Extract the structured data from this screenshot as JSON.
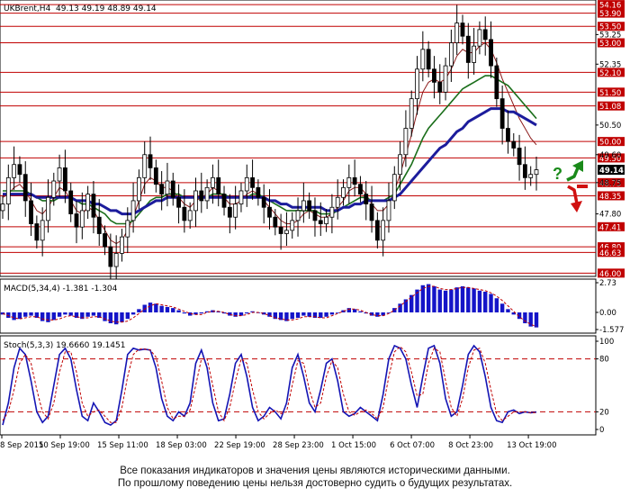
{
  "header": {
    "symbol": "UKBrent,H4",
    "ohlc": "49.13 49.19 48.89 49.14"
  },
  "disclaimer": {
    "line1": "Все показания индикаторов и значения цены являются историческими данными.",
    "line2": "По прошлому поведению цены нельзя достоверно судить о будущих результатах."
  },
  "colors": {
    "candle": "#000000",
    "level": "#c00000",
    "label_bg": "#c00000",
    "ma_fast": "#8b1a1a",
    "ma_mid": "#1a6e1a",
    "ma_slow": "#1c1c9c",
    "macd_hist": "#1414c8",
    "macd_signal": "#c00000",
    "stoch_main": "#1414b4",
    "stoch_signal": "#c00000",
    "arrow_up": "#1a8a1a",
    "arrow_down": "#d01010"
  },
  "icons": [
    "arrow-up-icon",
    "arrow-down-icon",
    "question-mark-icon"
  ],
  "chart_data": [
    {
      "type": "line",
      "name": "price",
      "ylim": [
        45.9,
        54.3
      ],
      "x_ticks": [
        "8 Sep 2015",
        "10 Sep 19:00",
        "15 Sep 11:00",
        "18 Sep 03:00",
        "22 Sep 19:00",
        "28 Sep 23:00",
        "1 Oct 15:00",
        "6 Oct 07:00",
        "8 Oct 23:00",
        "13 Oct 19:00"
      ],
      "y_ticks": [
        "53.25",
        "52.35",
        "50.50",
        "49.60",
        "48.75",
        "47.80"
      ],
      "resistance_levels": [
        "54.16",
        "53.90",
        "53.50",
        "53.00",
        "52.10",
        "51.50",
        "51.08",
        "50.00",
        "49.50",
        "48.75",
        "48.35",
        "47.41",
        "46.80",
        "46.63",
        "46.00"
      ],
      "current_price": "49.14",
      "annotation": "?",
      "closes": [
        48.1,
        48.9,
        49.3,
        49.0,
        48.2,
        47.5,
        47.0,
        47.6,
        48.3,
        48.8,
        49.2,
        48.5,
        47.8,
        47.4,
        47.9,
        48.4,
        47.7,
        47.2,
        46.8,
        46.2,
        46.6,
        47.1,
        47.6,
        48.2,
        48.9,
        49.6,
        49.2,
        48.7,
        48.4,
        48.8,
        48.3,
        48.0,
        47.6,
        47.9,
        48.5,
        48.2,
        48.6,
        48.9,
        48.4,
        48.0,
        47.7,
        48.1,
        48.5,
        48.9,
        48.6,
        48.3,
        48.0,
        47.7,
        47.4,
        47.2,
        47.3,
        47.6,
        47.9,
        48.2,
        47.9,
        47.6,
        47.5,
        47.7,
        48.0,
        48.3,
        48.6,
        48.9,
        48.7,
        48.4,
        48.1,
        47.6,
        47.0,
        47.6,
        48.2,
        49.0,
        49.6,
        50.4,
        51.3,
        52.2,
        52.8,
        52.2,
        51.8,
        51.5,
        52.3,
        53.0,
        53.6,
        53.2,
        52.4,
        52.9,
        53.4,
        53.1,
        52.3,
        51.3,
        50.4,
        50.0,
        49.8,
        49.3,
        48.9,
        49.0,
        49.14
      ],
      "moving_averages": [
        {
          "name": "ma_fast",
          "values": [
            48.3,
            48.4,
            48.6,
            48.7,
            48.5,
            48.2,
            47.9,
            47.8,
            48.0,
            48.3,
            48.6,
            48.5,
            48.2,
            47.9,
            47.8,
            48.0,
            47.9,
            47.6,
            47.3,
            47.0,
            46.9,
            47.0,
            47.3,
            47.7,
            48.2,
            48.7,
            48.9,
            48.8,
            48.6,
            48.6,
            48.5,
            48.3,
            48.1,
            48.0,
            48.2,
            48.3,
            48.4,
            48.6,
            48.5,
            48.3,
            48.1,
            48.1,
            48.2,
            48.4,
            48.5,
            48.4,
            48.2,
            48.0,
            47.8,
            47.6,
            47.5,
            47.5,
            47.6,
            47.8,
            47.9,
            47.8,
            47.7,
            47.7,
            47.8,
            48.0,
            48.2,
            48.5,
            48.6,
            48.6,
            48.4,
            48.1,
            47.9,
            47.9,
            48.1,
            48.5,
            49.0,
            49.6,
            50.2,
            50.9,
            51.5,
            51.8,
            51.9,
            51.8,
            51.9,
            52.2,
            52.6,
            52.8,
            52.7,
            52.7,
            52.9,
            53.0,
            52.8,
            52.4,
            51.9,
            51.5,
            51.1,
            50.7,
            50.4,
            50.1,
            49.9
          ]
        },
        {
          "name": "ma_mid",
          "values": [
            48.5,
            48.5,
            48.5,
            48.5,
            48.5,
            48.4,
            48.3,
            48.2,
            48.2,
            48.2,
            48.3,
            48.3,
            48.3,
            48.2,
            48.1,
            48.1,
            48.0,
            47.9,
            47.8,
            47.6,
            47.5,
            47.5,
            47.5,
            47.6,
            47.8,
            48.0,
            48.2,
            48.3,
            48.3,
            48.4,
            48.4,
            48.4,
            48.3,
            48.3,
            48.3,
            48.3,
            48.3,
            48.4,
            48.4,
            48.4,
            48.3,
            48.3,
            48.3,
            48.3,
            48.4,
            48.4,
            48.3,
            48.2,
            48.1,
            48.0,
            47.9,
            47.9,
            47.9,
            47.9,
            47.9,
            47.9,
            47.8,
            47.8,
            47.8,
            47.9,
            48.0,
            48.1,
            48.2,
            48.3,
            48.3,
            48.2,
            48.2,
            48.2,
            48.3,
            48.4,
            48.7,
            49.0,
            49.3,
            49.7,
            50.1,
            50.4,
            50.6,
            50.8,
            51.0,
            51.2,
            51.4,
            51.6,
            51.7,
            51.8,
            51.9,
            52.0,
            52.0,
            51.9,
            51.8,
            51.7,
            51.5,
            51.3,
            51.1,
            50.9,
            50.7
          ]
        },
        {
          "name": "ma_slow",
          "values": [
            48.4,
            48.4,
            48.4,
            48.4,
            48.4,
            48.4,
            48.3,
            48.3,
            48.3,
            48.3,
            48.3,
            48.3,
            48.3,
            48.2,
            48.2,
            48.2,
            48.1,
            48.1,
            48.0,
            47.9,
            47.9,
            47.8,
            47.8,
            47.8,
            47.9,
            48.0,
            48.1,
            48.2,
            48.2,
            48.3,
            48.3,
            48.3,
            48.3,
            48.3,
            48.3,
            48.3,
            48.3,
            48.3,
            48.3,
            48.3,
            48.3,
            48.3,
            48.3,
            48.3,
            48.3,
            48.3,
            48.3,
            48.2,
            48.2,
            48.1,
            48.1,
            48.0,
            48.0,
            48.0,
            48.0,
            48.0,
            48.0,
            47.9,
            47.9,
            47.9,
            48.0,
            48.0,
            48.1,
            48.1,
            48.2,
            48.2,
            48.2,
            48.2,
            48.2,
            48.3,
            48.4,
            48.6,
            48.8,
            49.0,
            49.2,
            49.4,
            49.6,
            49.8,
            49.9,
            50.1,
            50.3,
            50.4,
            50.6,
            50.7,
            50.8,
            50.9,
            51.0,
            51.0,
            51.0,
            50.9,
            50.9,
            50.8,
            50.7,
            50.6,
            50.5
          ]
        }
      ]
    },
    {
      "type": "bar",
      "name": "macd",
      "title": "MACD(5,34,4) -1.381 -1.304",
      "ylim": [
        -1.577,
        2.73
      ],
      "y_ticks": [
        "2.73",
        "0.00",
        "-1.577"
      ],
      "values": [
        -0.2,
        -0.5,
        -0.7,
        -0.6,
        -0.4,
        -0.3,
        -0.5,
        -0.8,
        -0.9,
        -0.7,
        -0.4,
        -0.2,
        -0.3,
        -0.5,
        -0.6,
        -0.4,
        -0.3,
        -0.5,
        -0.8,
        -1.0,
        -1.1,
        -0.9,
        -0.6,
        -0.2,
        0.3,
        0.7,
        0.9,
        0.8,
        0.6,
        0.5,
        0.4,
        0.2,
        -0.1,
        -0.3,
        -0.2,
        -0.1,
        0.1,
        0.2,
        0.1,
        -0.1,
        -0.3,
        -0.4,
        -0.3,
        -0.1,
        0.1,
        0.0,
        -0.2,
        -0.4,
        -0.6,
        -0.7,
        -0.8,
        -0.6,
        -0.5,
        -0.3,
        -0.4,
        -0.5,
        -0.5,
        -0.4,
        -0.2,
        0.0,
        0.2,
        0.4,
        0.3,
        0.1,
        -0.1,
        -0.3,
        -0.4,
        -0.3,
        0.0,
        0.4,
        0.8,
        1.2,
        1.6,
        2.1,
        2.5,
        2.6,
        2.4,
        2.1,
        2.0,
        2.1,
        2.3,
        2.4,
        2.3,
        2.2,
        2.0,
        1.9,
        1.7,
        1.3,
        0.8,
        0.3,
        -0.2,
        -0.6,
        -1.0,
        -1.3,
        -1.381
      ],
      "signal": [
        -0.1,
        -0.3,
        -0.5,
        -0.6,
        -0.5,
        -0.4,
        -0.4,
        -0.6,
        -0.7,
        -0.7,
        -0.6,
        -0.4,
        -0.3,
        -0.4,
        -0.5,
        -0.5,
        -0.4,
        -0.4,
        -0.6,
        -0.8,
        -0.9,
        -0.9,
        -0.8,
        -0.5,
        -0.1,
        0.3,
        0.6,
        0.8,
        0.7,
        0.6,
        0.5,
        0.3,
        0.1,
        -0.1,
        -0.2,
        -0.2,
        0.0,
        0.1,
        0.1,
        0.0,
        -0.2,
        -0.3,
        -0.3,
        -0.2,
        0.0,
        0.0,
        -0.1,
        -0.3,
        -0.5,
        -0.6,
        -0.7,
        -0.7,
        -0.6,
        -0.4,
        -0.4,
        -0.4,
        -0.5,
        -0.5,
        -0.3,
        -0.1,
        0.1,
        0.3,
        0.3,
        0.2,
        0.0,
        -0.2,
        -0.3,
        -0.3,
        -0.1,
        0.2,
        0.6,
        1.0,
        1.4,
        1.8,
        2.2,
        2.4,
        2.4,
        2.2,
        2.1,
        2.1,
        2.2,
        2.3,
        2.3,
        2.2,
        2.1,
        2.0,
        1.8,
        1.5,
        1.1,
        0.6,
        0.1,
        -0.4,
        -0.8,
        -1.1,
        -1.304
      ]
    },
    {
      "type": "line",
      "name": "stochastic",
      "title": "Stoch(5,3,3) 19.6660 19.1451",
      "ylim": [
        0,
        100
      ],
      "y_ticks": [
        "100",
        "80",
        "20",
        "0"
      ],
      "levels": [
        80,
        20
      ],
      "series": [
        {
          "name": "main",
          "values": [
            5,
            30,
            70,
            92,
            85,
            55,
            20,
            8,
            15,
            50,
            85,
            92,
            80,
            45,
            15,
            10,
            30,
            20,
            8,
            5,
            10,
            45,
            85,
            92,
            90,
            91,
            90,
            70,
            35,
            15,
            10,
            20,
            15,
            30,
            75,
            90,
            70,
            30,
            10,
            12,
            40,
            75,
            85,
            60,
            25,
            10,
            15,
            25,
            20,
            12,
            30,
            70,
            85,
            60,
            30,
            20,
            45,
            75,
            80,
            55,
            20,
            15,
            18,
            25,
            20,
            15,
            10,
            40,
            80,
            95,
            92,
            80,
            50,
            25,
            60,
            92,
            95,
            75,
            35,
            15,
            20,
            50,
            85,
            95,
            88,
            60,
            25,
            10,
            8,
            20,
            22,
            18,
            20,
            19,
            19.67
          ]
        },
        {
          "name": "signal",
          "values": [
            10,
            20,
            45,
            75,
            85,
            75,
            45,
            20,
            12,
            30,
            65,
            88,
            88,
            65,
            30,
            15,
            20,
            22,
            15,
            8,
            8,
            25,
            60,
            85,
            91,
            91,
            90,
            82,
            55,
            25,
            12,
            15,
            15,
            22,
            50,
            80,
            80,
            50,
            20,
            10,
            25,
            55,
            80,
            75,
            45,
            20,
            12,
            18,
            22,
            18,
            20,
            50,
            78,
            75,
            45,
            25,
            30,
            60,
            78,
            70,
            40,
            20,
            16,
            20,
            22,
            18,
            12,
            25,
            60,
            88,
            94,
            88,
            65,
            38,
            40,
            75,
            92,
            88,
            55,
            25,
            15,
            35,
            70,
            90,
            92,
            75,
            45,
            18,
            10,
            15,
            20,
            20,
            20,
            19,
            19.15
          ]
        }
      ]
    }
  ]
}
